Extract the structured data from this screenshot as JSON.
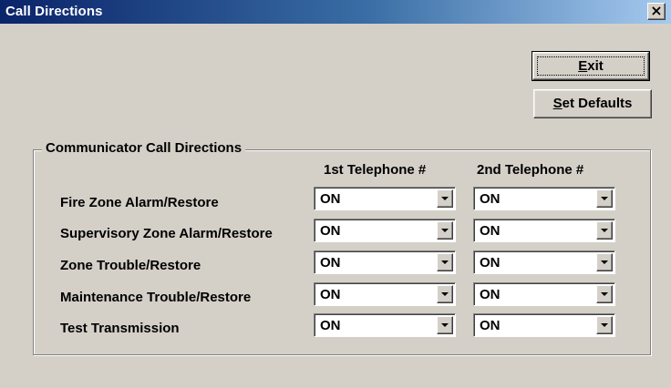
{
  "window": {
    "title": "Call Directions",
    "close_symbol": "×"
  },
  "buttons": {
    "exit_prefix": "",
    "exit_mnemonic": "E",
    "exit_rest": "xit",
    "defaults_mnemonic": "S",
    "defaults_rest": "et Defaults"
  },
  "group": {
    "label": "Communicator Call Directions",
    "col1_header": "1st Telephone #",
    "col2_header": "2nd Telephone #"
  },
  "rows": [
    {
      "label": "Fire Zone Alarm/Restore",
      "tel1": "ON",
      "tel2": "ON"
    },
    {
      "label": "Supervisory Zone Alarm/Restore",
      "tel1": "ON",
      "tel2": "ON"
    },
    {
      "label": "Zone Trouble/Restore",
      "tel1": "ON",
      "tel2": "ON"
    },
    {
      "label": "Maintenance Trouble/Restore",
      "tel1": "ON",
      "tel2": "ON"
    },
    {
      "label": "Test Transmission",
      "tel1": "ON",
      "tel2": "ON"
    }
  ],
  "icons": {
    "close": "close-icon",
    "dropdown": "chevron-down-icon"
  },
  "colors": {
    "title_gradient_start": "#0a246a",
    "title_gradient_end": "#a6caf0",
    "face": "#d4d0c8"
  }
}
